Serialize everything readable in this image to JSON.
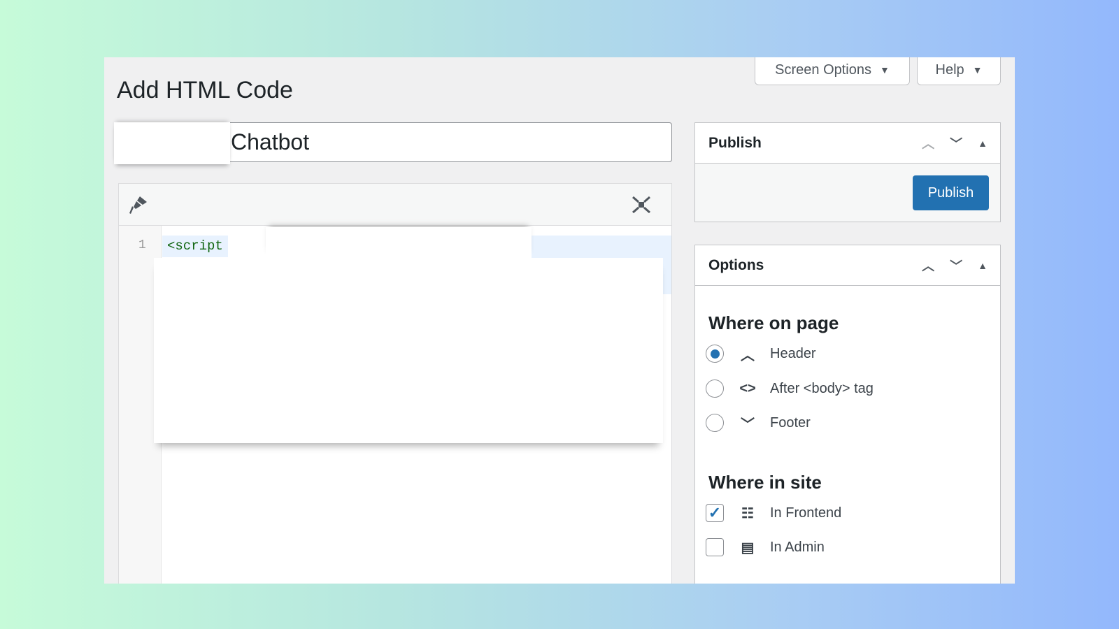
{
  "header": {
    "title": "Add HTML Code",
    "screen_options": "Screen Options",
    "help": "Help"
  },
  "post_title": {
    "value": "Chatbot"
  },
  "editor": {
    "line_numbers": [
      "1"
    ],
    "code_line_1": "<script",
    "toolbar_icons": [
      "paintbrush-icon",
      "fullscreen-icon"
    ]
  },
  "publish": {
    "title": "Publish",
    "button": "Publish"
  },
  "options": {
    "title": "Options",
    "where_on_page": {
      "heading": "Where on page",
      "items": [
        {
          "label": "Header",
          "icon": "chevron-up",
          "selected": true
        },
        {
          "label": "After <body> tag",
          "icon": "code-brackets",
          "selected": false
        },
        {
          "label": "Footer",
          "icon": "chevron-down",
          "selected": false
        }
      ]
    },
    "where_in_site": {
      "heading": "Where in site",
      "items": [
        {
          "label": "In Frontend",
          "icon": "layout-grid",
          "checked": true
        },
        {
          "label": "In Admin",
          "icon": "id-card",
          "checked": false
        }
      ]
    }
  },
  "colors": {
    "accent": "#2271b1",
    "code_text": "#116611"
  }
}
